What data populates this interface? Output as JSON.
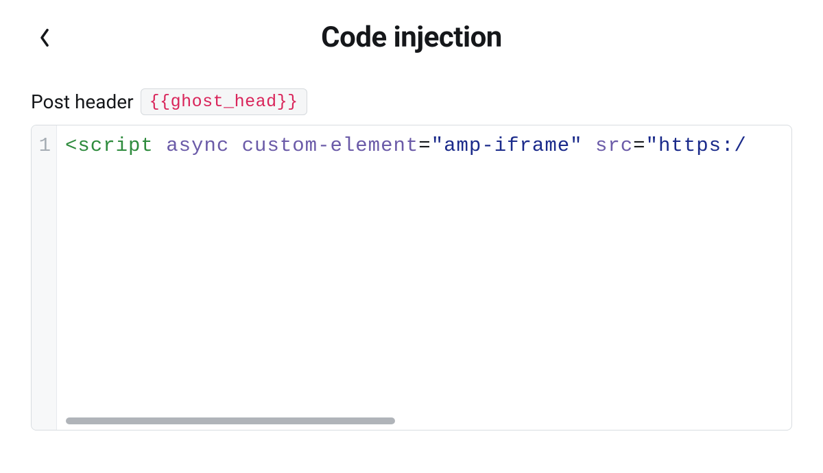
{
  "header": {
    "title": "Code injection"
  },
  "section": {
    "label": "Post header",
    "template_tag": "{{ghost_head}}"
  },
  "editor": {
    "line_numbers": [
      "1"
    ],
    "tokens": [
      {
        "cls": "tok-bracket",
        "text": "<"
      },
      {
        "cls": "tok-tag",
        "text": "script"
      },
      {
        "cls": "",
        "text": " "
      },
      {
        "cls": "tok-attr",
        "text": "async"
      },
      {
        "cls": "",
        "text": " "
      },
      {
        "cls": "tok-attr",
        "text": "custom-element"
      },
      {
        "cls": "tok-eq",
        "text": "="
      },
      {
        "cls": "tok-string",
        "text": "\"amp-iframe\""
      },
      {
        "cls": "",
        "text": " "
      },
      {
        "cls": "tok-attr",
        "text": "src"
      },
      {
        "cls": "tok-eq",
        "text": "="
      },
      {
        "cls": "tok-string",
        "text": "\"https:/"
      }
    ]
  }
}
